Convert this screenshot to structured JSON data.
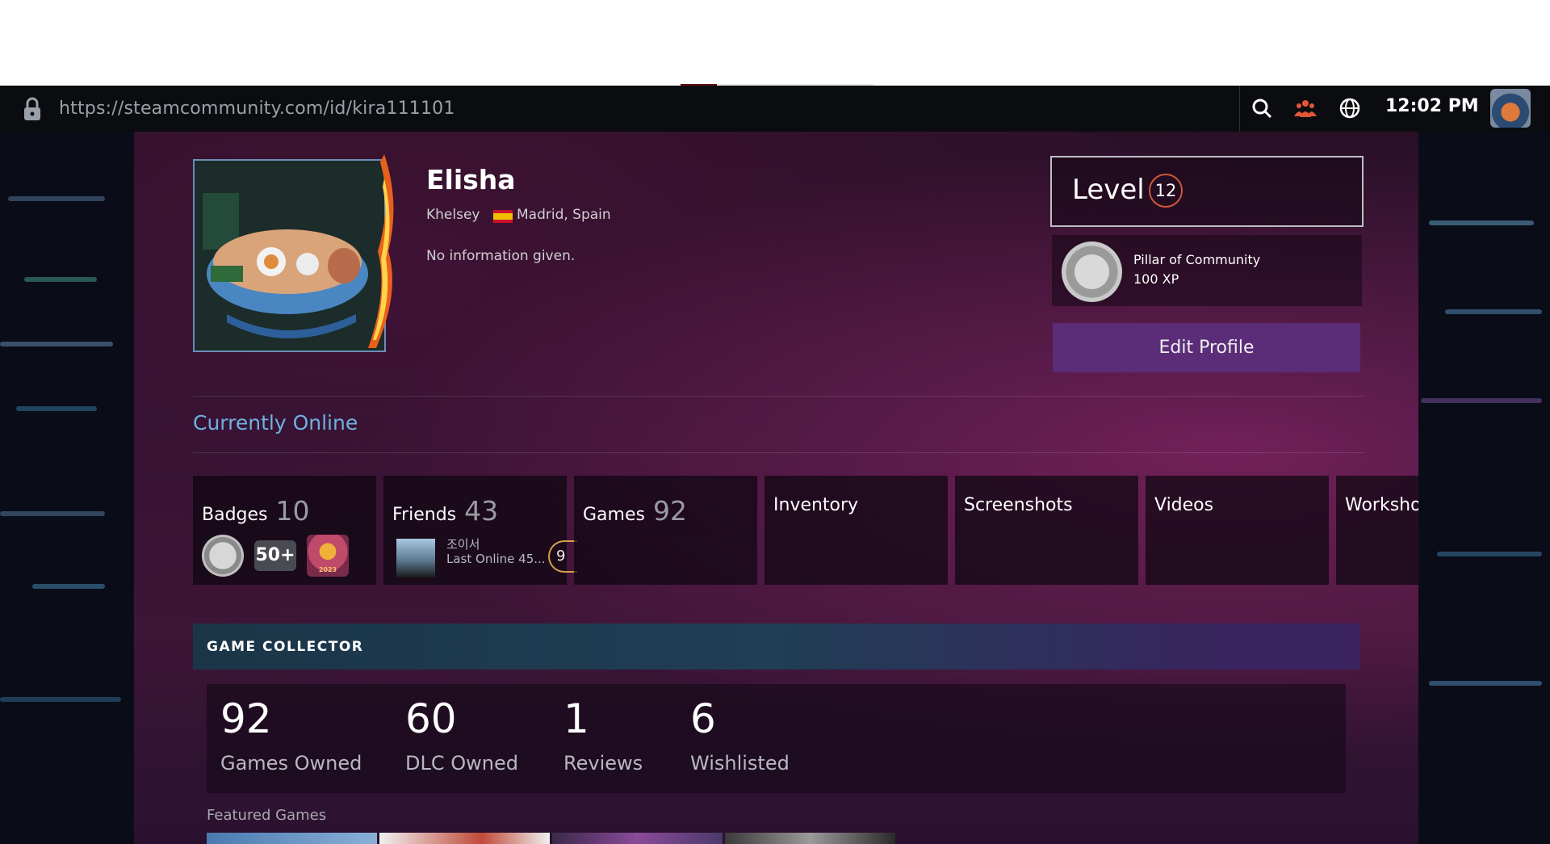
{
  "browser": {
    "url": "https://steamcommunity.com/id/kira111101",
    "time": "12:02 PM"
  },
  "profile": {
    "persona_name": "Elisha",
    "real_name": "Khelsey",
    "location": "Madrid, Spain",
    "summary": "No information given.",
    "status": "Currently Online"
  },
  "level": {
    "label": "Level",
    "value": "12"
  },
  "favorite_badge": {
    "name": "Pillar of Community",
    "xp": "100 XP"
  },
  "edit_profile_label": "Edit Profile",
  "tiles": [
    {
      "label": "Badges",
      "count": "10"
    },
    {
      "label": "Friends",
      "count": "43"
    },
    {
      "label": "Games",
      "count": "92"
    },
    {
      "label": "Inventory",
      "count": ""
    },
    {
      "label": "Screenshots",
      "count": ""
    },
    {
      "label": "Videos",
      "count": ""
    },
    {
      "label": "Worksho",
      "count": ""
    }
  ],
  "badges_preview": {
    "second_label": "50+",
    "third_label": "2023"
  },
  "friend_preview": {
    "name": "조이서",
    "status": "Last Online 45...",
    "level_partial": "9"
  },
  "showcase": {
    "title": "GAME COLLECTOR",
    "stats": [
      {
        "value": "92",
        "label": "Games Owned"
      },
      {
        "value": "60",
        "label": "DLC Owned"
      },
      {
        "value": "1",
        "label": "Reviews"
      },
      {
        "value": "6",
        "label": "Wishlisted"
      }
    ],
    "featured_label": "Featured Games"
  },
  "colors": {
    "accent_status": "#6fb1de",
    "edit_button": "#5b2d78",
    "level_ring": "#d0563b"
  },
  "icons": {
    "lock": "lock-icon",
    "search": "search-icon",
    "friends": "friends-icon",
    "globe": "globe-icon"
  }
}
